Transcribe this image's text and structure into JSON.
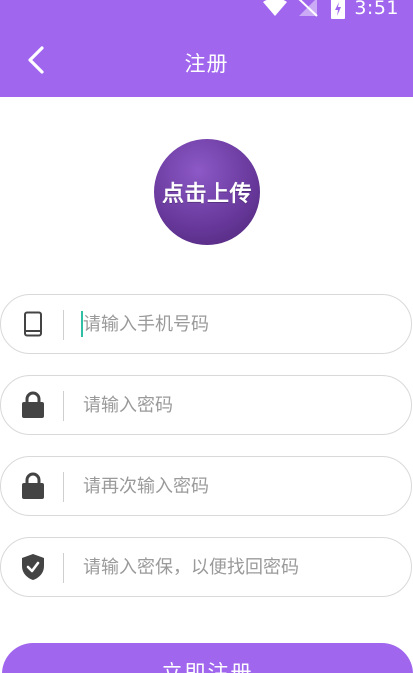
{
  "status_bar": {
    "time": "3:51",
    "icons": [
      "wifi-icon",
      "signal-icon",
      "battery-charging-icon"
    ]
  },
  "header": {
    "title": "注册",
    "back_icon": "chevron-left-icon"
  },
  "avatar": {
    "label": "点击上传"
  },
  "fields": [
    {
      "icon": "phone-icon",
      "placeholder": "请输入手机号码",
      "value": ""
    },
    {
      "icon": "lock-icon",
      "placeholder": "请输入密码",
      "value": ""
    },
    {
      "icon": "lock-icon",
      "placeholder": "请再次输入密码",
      "value": ""
    },
    {
      "icon": "shield-check-icon",
      "placeholder": "请输入密保，以便找回密码",
      "value": ""
    }
  ],
  "submit": {
    "label": "立即注册"
  },
  "colors": {
    "primary": "#a067ee",
    "avatar": "#6a3a9e",
    "caret": "#2fbfa5",
    "icon": "#444444"
  }
}
